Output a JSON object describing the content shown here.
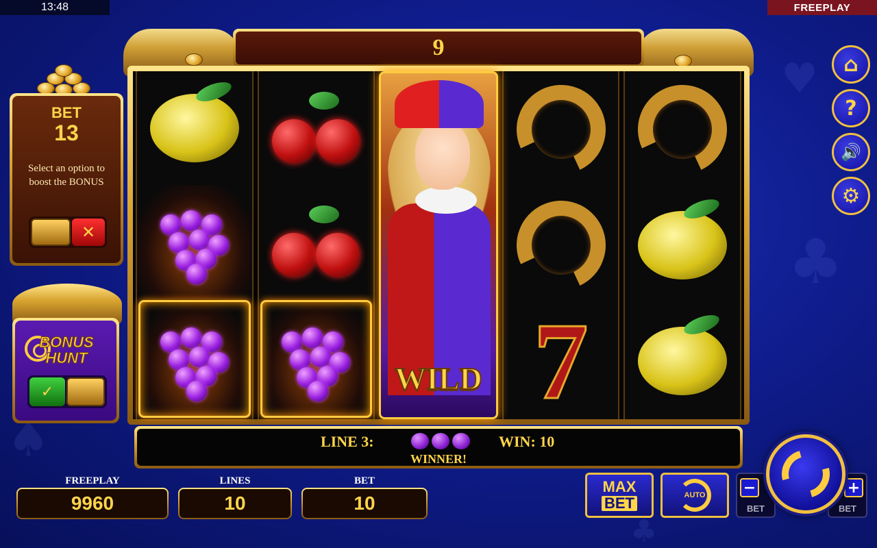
{
  "status_bar": {
    "time": "13:48",
    "mode": "FREEPLAY"
  },
  "top_banner": {
    "value": "9"
  },
  "reels": [
    [
      "lemon",
      "grapes",
      "grapes"
    ],
    [
      "cherries",
      "cherries",
      "grapes"
    ],
    [
      "wild-jester"
    ],
    [
      "horseshoe",
      "horseshoe",
      "seven"
    ],
    [
      "horseshoe",
      "lemon",
      "lemon"
    ]
  ],
  "wild_label": "WILD",
  "seven_symbol": "7",
  "win_bar": {
    "line": "LINE 3:",
    "win": "WIN: 10",
    "message": "WINNER!"
  },
  "bet_panel": {
    "title": "BET",
    "value": "13",
    "description": "Select an option to boost the BONUS",
    "cancel_glyph": "✕"
  },
  "bonus_hunt": {
    "title_line1": "BONUS",
    "title_line2": "HUNT",
    "confirm_glyph": "✓"
  },
  "bottom": {
    "freeplay_label": "FREEPLAY",
    "freeplay_value": "9960",
    "lines_label": "LINES",
    "lines_value": "10",
    "bet_label": "BET",
    "bet_value": "10"
  },
  "controls": {
    "maxbet_line1": "MAX",
    "maxbet_line2": "BET",
    "auto_label": "AUTO",
    "bet_minus_glyph": "−",
    "bet_minus_label": "BET",
    "bet_plus_glyph": "+",
    "bet_plus_label": "BET"
  },
  "side_menu": {
    "home": "⌂",
    "help": "?",
    "sound": "🔊",
    "settings": "⚙"
  },
  "colors": {
    "gold": "#ffd54a",
    "background": "#1a2fb8",
    "freeplay_tag": "#7a1520"
  }
}
